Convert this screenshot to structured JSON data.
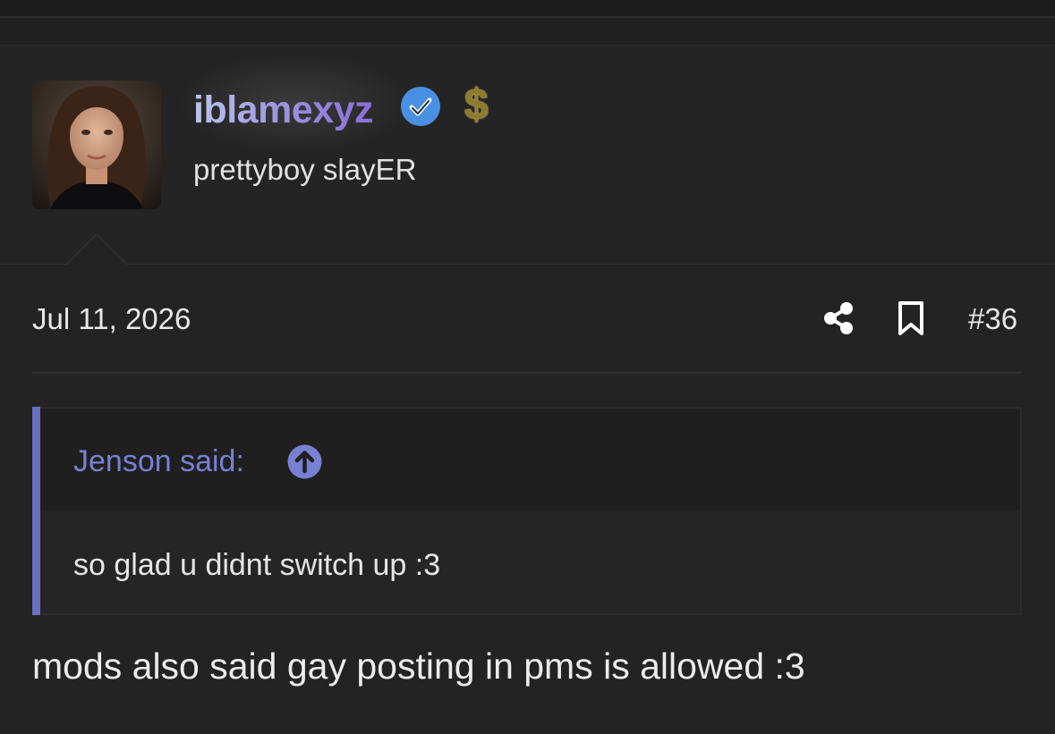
{
  "user": {
    "username": "iblamexyz",
    "title": "prettyboy slayER",
    "verified_icon": "verified-check-icon",
    "badge_icon": "dollar-sign-icon",
    "badge_glyph": "$",
    "colors": {
      "username_start": "#b9c4ec",
      "username_end": "#8a6fd8",
      "verified_blue": "#4a90e2",
      "dollar_gold": "#e8c96a"
    }
  },
  "post": {
    "date": "Jul 11, 2026",
    "number": "#36",
    "share_icon": "share-icon",
    "bookmark_icon": "bookmark-icon",
    "quote": {
      "author_label": "Jenson said:",
      "jump_icon": "arrow-up-circle-icon",
      "text": "so glad u didnt switch up :3",
      "accent_color": "#6a6fc0"
    },
    "body": "mods also said gay posting in pms is allowed :3"
  }
}
